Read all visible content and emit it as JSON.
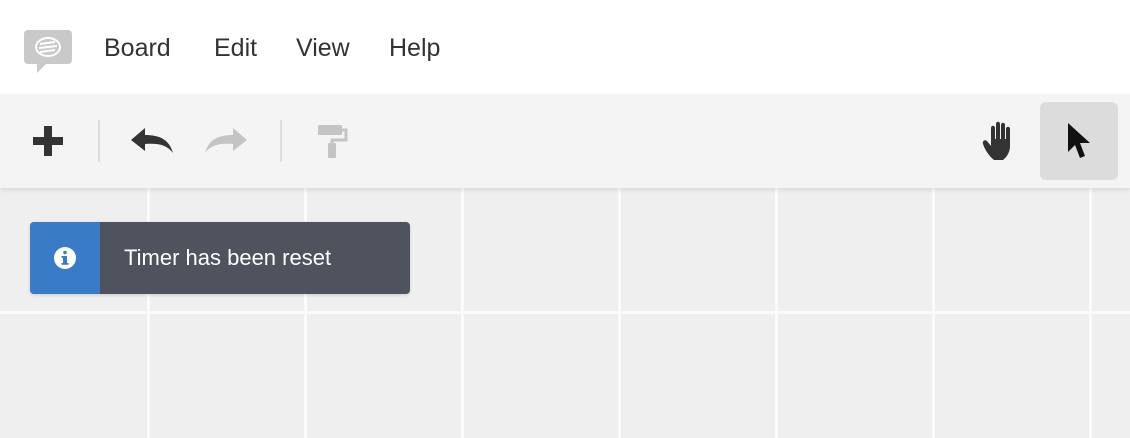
{
  "menubar": {
    "logo_icon": "speech-bubble-logo-icon",
    "items": [
      {
        "label": "Board"
      },
      {
        "label": "Edit"
      },
      {
        "label": "View"
      },
      {
        "label": "Help"
      }
    ]
  },
  "toolbar": {
    "tools": [
      {
        "name": "add",
        "icon": "plus-icon",
        "enabled": true
      },
      {
        "name": "undo",
        "icon": "undo-icon",
        "enabled": true
      },
      {
        "name": "redo",
        "icon": "redo-icon",
        "enabled": false
      },
      {
        "name": "format-painter",
        "icon": "paint-roller-icon",
        "enabled": false
      },
      {
        "name": "pan",
        "icon": "hand-icon",
        "enabled": true
      },
      {
        "name": "select",
        "icon": "cursor-arrow-icon",
        "enabled": true,
        "active": true
      }
    ]
  },
  "toast": {
    "icon": "info-icon",
    "message": "Timer has been reset",
    "accent_color": "#3a7bc8",
    "background_color": "#4e535e"
  }
}
